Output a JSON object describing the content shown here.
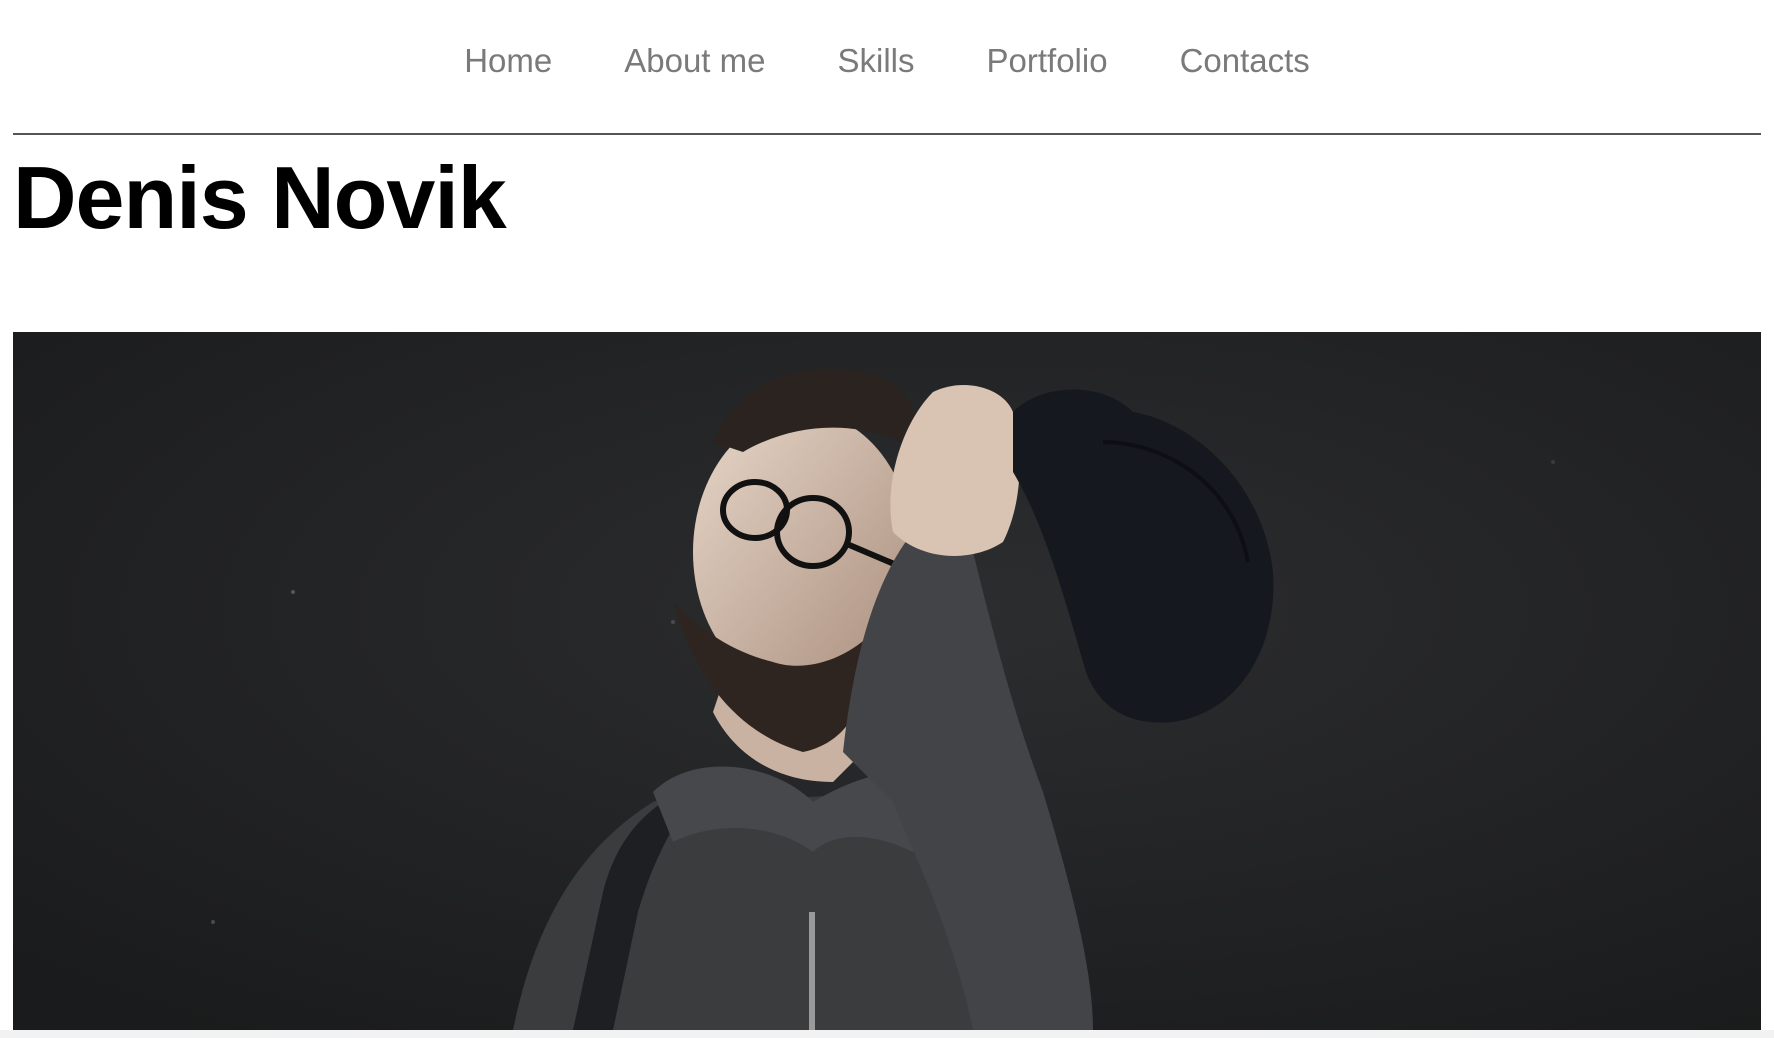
{
  "nav": {
    "items": [
      {
        "label": "Home"
      },
      {
        "label": "About me"
      },
      {
        "label": "Skills"
      },
      {
        "label": "Portfolio"
      },
      {
        "label": "Contacts"
      }
    ]
  },
  "header": {
    "title": "Denis Novik"
  },
  "colors": {
    "nav_text": "#7a7a7a",
    "divider": "#555555",
    "title_text": "#000000",
    "hero_background": "#222324"
  }
}
